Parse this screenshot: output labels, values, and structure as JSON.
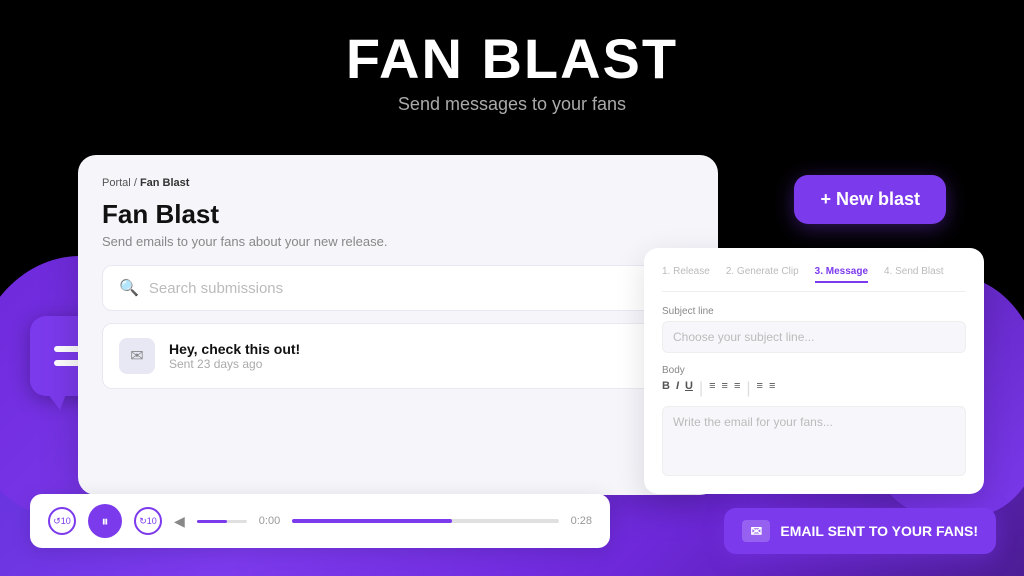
{
  "header": {
    "title": "FAN BLAST",
    "subtitle": "Send messages to your fans"
  },
  "breadcrumb": {
    "portal": "Portal",
    "separator": "/",
    "current": "Fan Blast"
  },
  "main_card": {
    "title": "Fan Blast",
    "subtitle": "Send emails to your fans about your new release."
  },
  "new_blast_button": "+ New blast",
  "search": {
    "placeholder": "Search submissions"
  },
  "email_item": {
    "title": "Hey, check this out!",
    "sent": "Sent 23 days ago"
  },
  "editor": {
    "steps": [
      {
        "label": "1. Release",
        "active": false
      },
      {
        "label": "2. Generate Clip",
        "active": false
      },
      {
        "label": "3. Message",
        "active": true
      },
      {
        "label": "4. Send Blast",
        "active": false
      }
    ],
    "subject_label": "Subject line",
    "subject_placeholder": "Choose your subject line...",
    "body_label": "Body",
    "body_placeholder": "Write the email for your fans...",
    "toolbar": [
      "B",
      "I",
      "U",
      "≡",
      "≡",
      "≡",
      "≡"
    ]
  },
  "audio_player": {
    "time_start": "0:00",
    "time_end": "0:28",
    "progress": 60
  },
  "toast": {
    "text": "EMAIL SENT TO YOUR FANS!",
    "icon": "✉"
  }
}
